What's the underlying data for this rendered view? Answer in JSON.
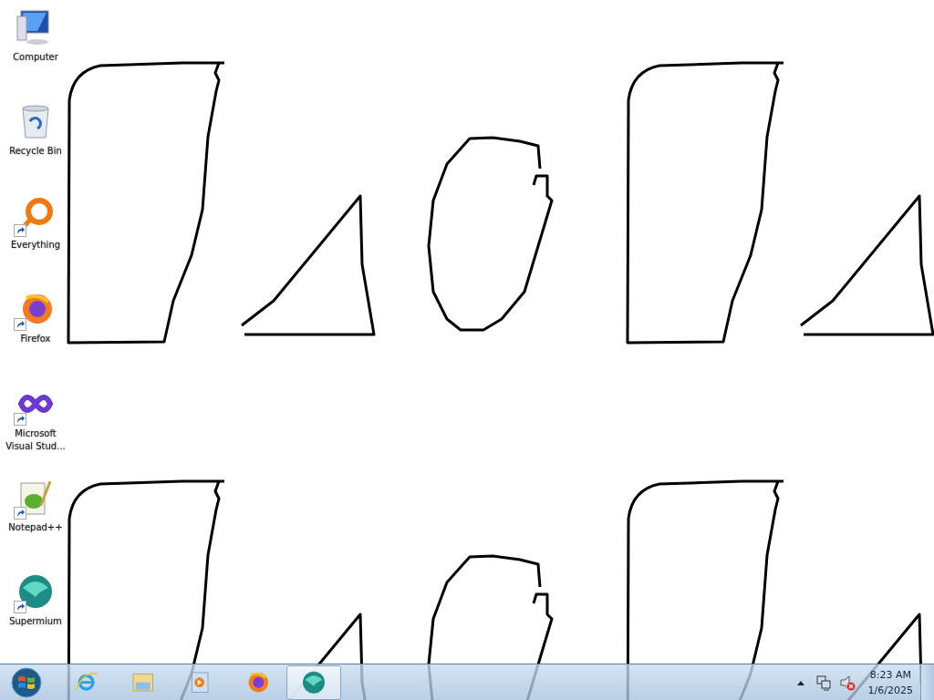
{
  "desktop_icons": [
    {
      "kind": "computer",
      "label": "Computer",
      "shortcut": false
    },
    {
      "kind": "recycle",
      "label": "Recycle Bin",
      "shortcut": false
    },
    {
      "kind": "everything",
      "label": "Everything",
      "shortcut": true
    },
    {
      "kind": "firefox",
      "label": "Firefox",
      "shortcut": true
    },
    {
      "kind": "vs",
      "label": "Microsoft Visual Stud...",
      "shortcut": true
    },
    {
      "kind": "notepad",
      "label": "Notepad++",
      "shortcut": true
    },
    {
      "kind": "supermium",
      "label": "Supermium",
      "shortcut": true
    }
  ],
  "taskbar": {
    "items": [
      {
        "kind": "ie",
        "selected": false
      },
      {
        "kind": "explorer",
        "selected": false
      },
      {
        "kind": "media",
        "selected": false
      },
      {
        "kind": "firefox",
        "selected": false
      },
      {
        "kind": "supermium",
        "selected": true
      }
    ],
    "tray": {
      "volume_muted": true,
      "time": "8:23 AM",
      "date": "1/6/2025"
    }
  }
}
